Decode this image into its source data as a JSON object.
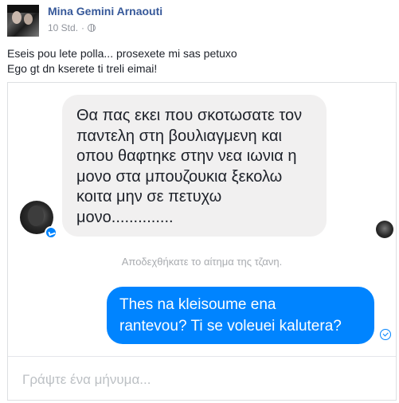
{
  "post": {
    "author": "Mina Gemini Arnaouti",
    "timestamp": "10 Std.",
    "separator": "·",
    "privacy_icon": "globe-icon",
    "text_line_1": "Eseis pou lete polla... prosexete mi sas petuxo",
    "text_line_2": "Ego gt dn kserete ti treli eimai!"
  },
  "chat": {
    "incoming_message": "Θα πας εκει που σκοτωσατε τον\nπαντελη στη βουλιαγμενη και\nοπου θαφτηκε στην νεα ιωνια η\nμονο στα μπουζουκια ξεκολω\nκοιτα μην σε πετυχω\nμονο..............",
    "system_notice": "Αποδεχθήκατε το αίτημα της τζανη.",
    "outgoing_message": "Thes na kleisoume ena\nrantevou? Ti se voleuei kalutera?",
    "composer_placeholder": "Γράψτε ένα μήνυμα...",
    "colors": {
      "outgoing_bubble": "#0084ff",
      "incoming_bubble": "#f1f0f0",
      "author_link": "#365899"
    }
  }
}
